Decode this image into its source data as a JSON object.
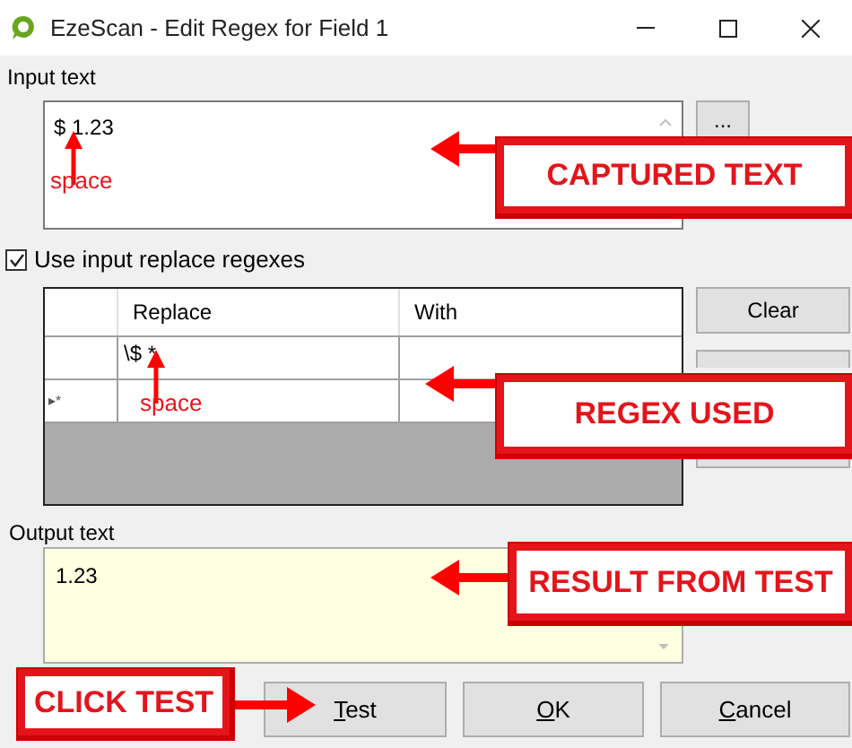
{
  "window": {
    "title": "EzeScan - Edit Regex for Field 1"
  },
  "input_text": {
    "label": "Input text",
    "value": "$ 1.23",
    "side_button": "..."
  },
  "use_replace": {
    "label": "Use input replace regexes",
    "checked": true
  },
  "regex_table": {
    "columns": [
      "Replace",
      "With"
    ],
    "rows": [
      {
        "marker": "",
        "replace": "\\$ *",
        "with": ""
      },
      {
        "marker": "▸*",
        "replace": "",
        "with": ""
      }
    ]
  },
  "side_buttons": [
    "Clear"
  ],
  "output_text": {
    "label": "Output text",
    "value": "1.23"
  },
  "buttons": [
    {
      "label": "Test"
    },
    {
      "label": "OK"
    },
    {
      "label": "Cancel"
    }
  ],
  "annotations": [
    {
      "kind": "note",
      "text": "space"
    },
    {
      "kind": "callout",
      "text": "CAPTURED TEXT"
    },
    {
      "kind": "note",
      "text": "space"
    },
    {
      "kind": "callout",
      "text": "REGEX USED"
    },
    {
      "kind": "callout",
      "text": "RESULT FROM TEST"
    },
    {
      "kind": "callout",
      "text": "CLICK TEST"
    }
  ]
}
